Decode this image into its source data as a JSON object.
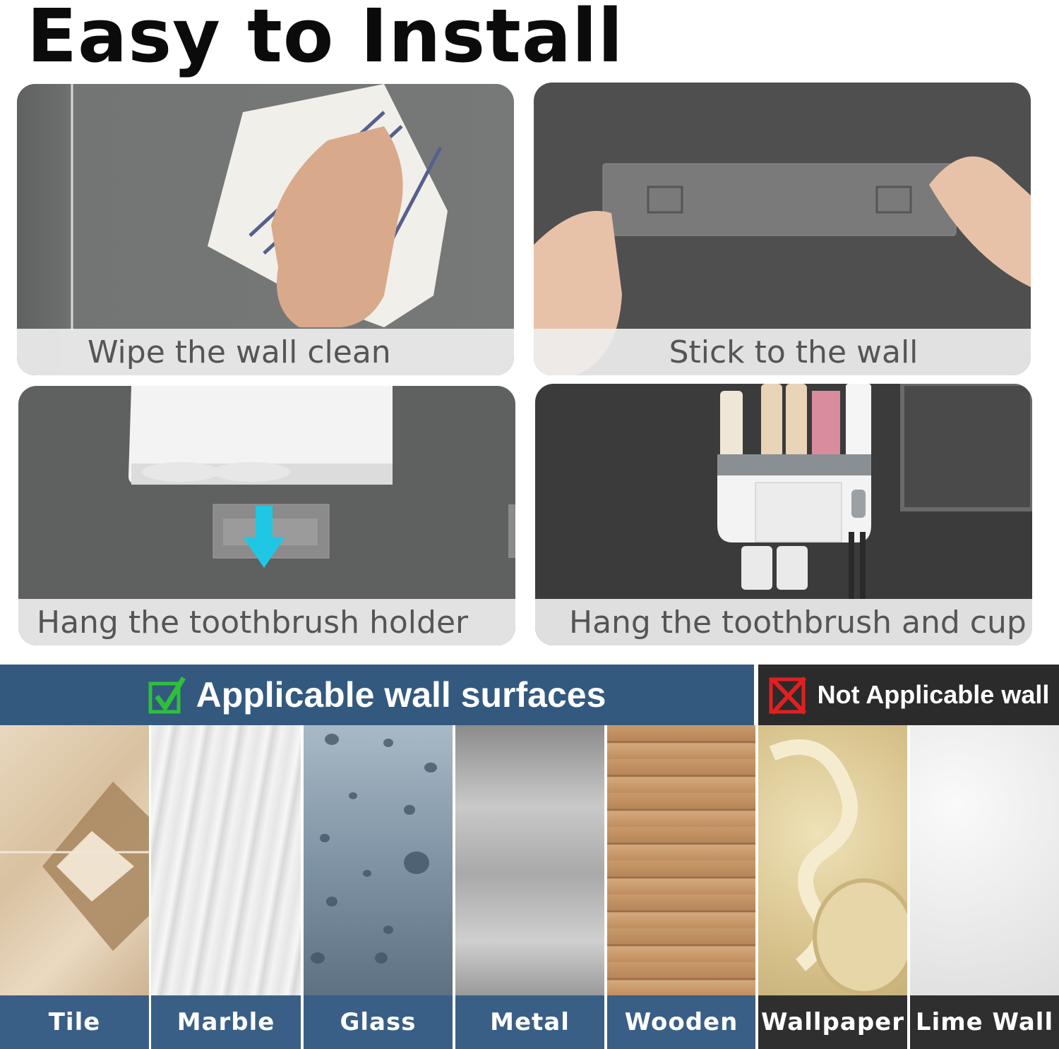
{
  "title": "Easy to Install",
  "steps": [
    {
      "caption": "Wipe the wall clean",
      "icon": "hand-wiping-icon"
    },
    {
      "caption": "Stick to the wall",
      "icon": "adhesive-strip-icon"
    },
    {
      "caption": "Hang the toothbrush holder",
      "icon": "arrow-down-icon"
    },
    {
      "caption": "Hang the toothbrush and cup",
      "icon": "toothbrush-holder-icon"
    }
  ],
  "applicable": {
    "label": "Applicable wall surfaces",
    "icon": "checkmark-icon",
    "surfaces": [
      "Tile",
      "Marble",
      "Glass",
      "Metal",
      "Wooden"
    ]
  },
  "not_applicable": {
    "label": "Not Applicable wall",
    "icon": "x-mark-icon",
    "surfaces": [
      "Wallpaper",
      "Lime Wall"
    ]
  },
  "colors": {
    "applicable_band": "#33597f",
    "not_applicable_band": "#2b2b2b",
    "check": "#2fbf3a",
    "cross": "#e02020",
    "arrow": "#1fc7e4"
  }
}
